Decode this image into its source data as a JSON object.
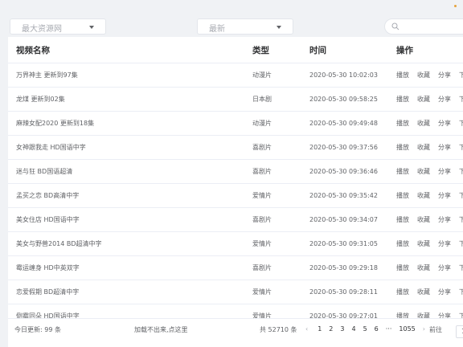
{
  "filters": {
    "source": "最大资源网",
    "category": "最新",
    "search_placeholder": ""
  },
  "table": {
    "headers": [
      "视频名称",
      "类型",
      "时间",
      "操作"
    ],
    "rows": [
      {
        "name": "万界神主 更新到97集",
        "type": "动漫片",
        "time": "2020-05-30 10:02:03"
      },
      {
        "name": "龙煤 更新到02集",
        "type": "日本剧",
        "time": "2020-05-30 09:58:25"
      },
      {
        "name": "麻辣女配2020 更新到18集",
        "type": "动漫片",
        "time": "2020-05-30 09:49:48"
      },
      {
        "name": "女神跟我走 HD国语中字",
        "type": "喜剧片",
        "time": "2020-05-30 09:37:56"
      },
      {
        "name": "迷与狂 BD国语超清",
        "type": "喜剧片",
        "time": "2020-05-30 09:36:46"
      },
      {
        "name": "孟买之恋 BD高清中字",
        "type": "爱情片",
        "time": "2020-05-30 09:35:42"
      },
      {
        "name": "美女住店 HD国语中字",
        "type": "喜剧片",
        "time": "2020-05-30 09:34:07"
      },
      {
        "name": "美女与野兽2014 BD超清中字",
        "type": "爱情片",
        "time": "2020-05-30 09:31:05"
      },
      {
        "name": "霉运缠身 HD中英双字",
        "type": "喜剧片",
        "time": "2020-05-30 09:29:18"
      },
      {
        "name": "恋爱假期 BD超清中字",
        "type": "爱情片",
        "time": "2020-05-30 09:28:11"
      },
      {
        "name": "倒霉同朵 HD国语中字",
        "type": "爱情片",
        "time": "2020-05-30 09:27:01"
      }
    ],
    "actions": [
      "播放",
      "收藏",
      "分享",
      "下"
    ]
  },
  "footer": {
    "today_update": "今日更新: 99 条",
    "load_fail": "加载不出来,点这里",
    "total": "共 52710 条",
    "prev": "‹",
    "pages": [
      "1",
      "2",
      "3",
      "4",
      "5",
      "6",
      "···",
      "1055"
    ],
    "next": "›",
    "goto_label": "前往",
    "goto_value": "1"
  },
  "icons": {
    "search": "search-icon",
    "caret": "chevron-down-icon"
  },
  "colors": {
    "accent": "#e6a23c",
    "background": "#f0f2f5"
  }
}
